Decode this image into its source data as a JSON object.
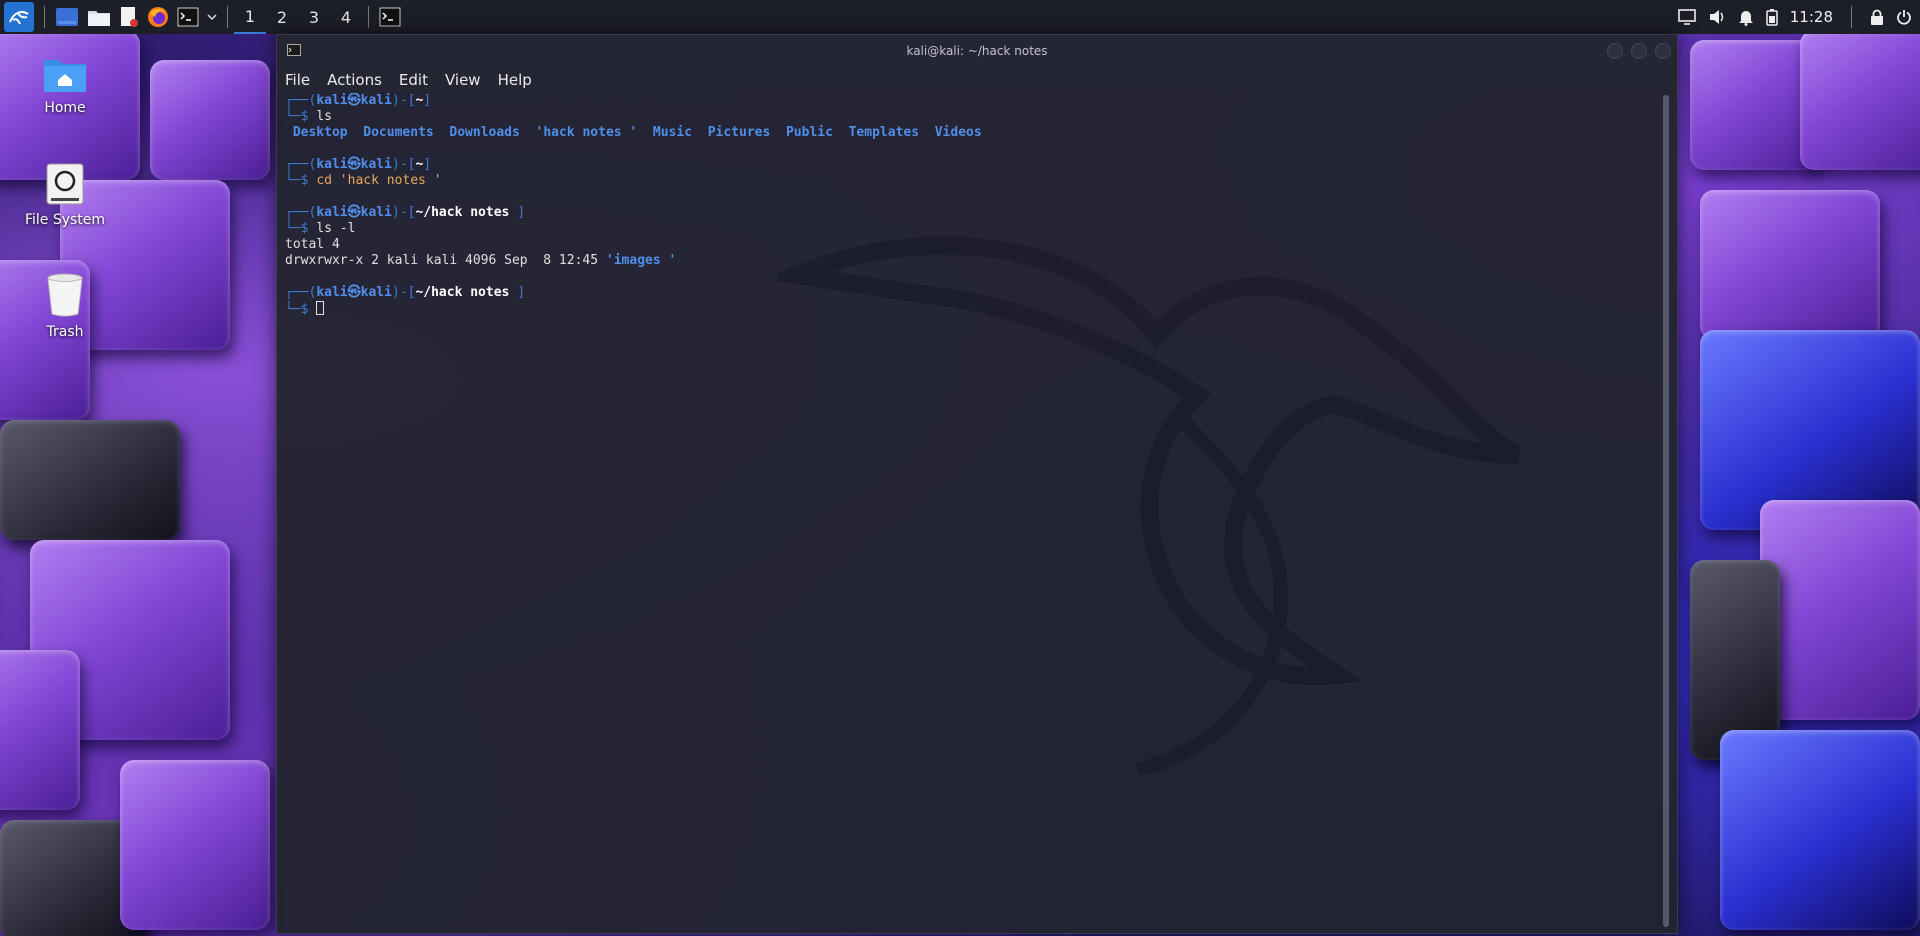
{
  "panel": {
    "workspaces": [
      "1",
      "2",
      "3",
      "4"
    ],
    "active_workspace": "1",
    "clock": "11:28",
    "launcher_icons": [
      "kali-menu-icon",
      "show-desktop-icon",
      "file-manager-icon",
      "text-editor-icon",
      "firefox-icon",
      "terminal-icon",
      "chevron-down-icon"
    ],
    "tray_icons": [
      "display-icon",
      "volume-icon",
      "notification-bell-icon",
      "battery-icon",
      "lock-icon",
      "power-icon"
    ]
  },
  "desktop": {
    "icons": [
      {
        "label": "Home",
        "icon": "home-folder-icon"
      },
      {
        "label": "File System",
        "icon": "file-system-icon"
      },
      {
        "label": "Trash",
        "icon": "trash-icon"
      }
    ]
  },
  "terminal": {
    "title": "kali@kali: ~/hack notes",
    "menu": [
      "File",
      "Actions",
      "Edit",
      "View",
      "Help"
    ],
    "prompt_user": "kali",
    "prompt_host": "kali",
    "prompt_symbol": "㉿",
    "lines": {
      "p1_path": "~",
      "c1": "ls",
      "ls_out": [
        "Desktop",
        "Documents",
        "Downloads",
        "'hack notes '",
        "Music",
        "Pictures",
        "Public",
        "Templates",
        "Videos"
      ],
      "p2_path": "~",
      "c2": "cd 'hack notes '",
      "p3_path": "~/hack notes ",
      "c3": "ls -l",
      "total": "total 4",
      "ll_perm": "drwxrwxr-x 2 kali kali 4096 Sep  8 12:45 ",
      "ll_name": "'images '",
      "p4_path": "~/hack notes "
    }
  },
  "colors": {
    "panel_bg": "#1d1f28",
    "terminal_bg": "#222430",
    "prompt_blue": "#3b7bd4",
    "dir_blue": "#4f8fea",
    "string_orange": "#e8a85a",
    "accent": "#2473d3"
  }
}
